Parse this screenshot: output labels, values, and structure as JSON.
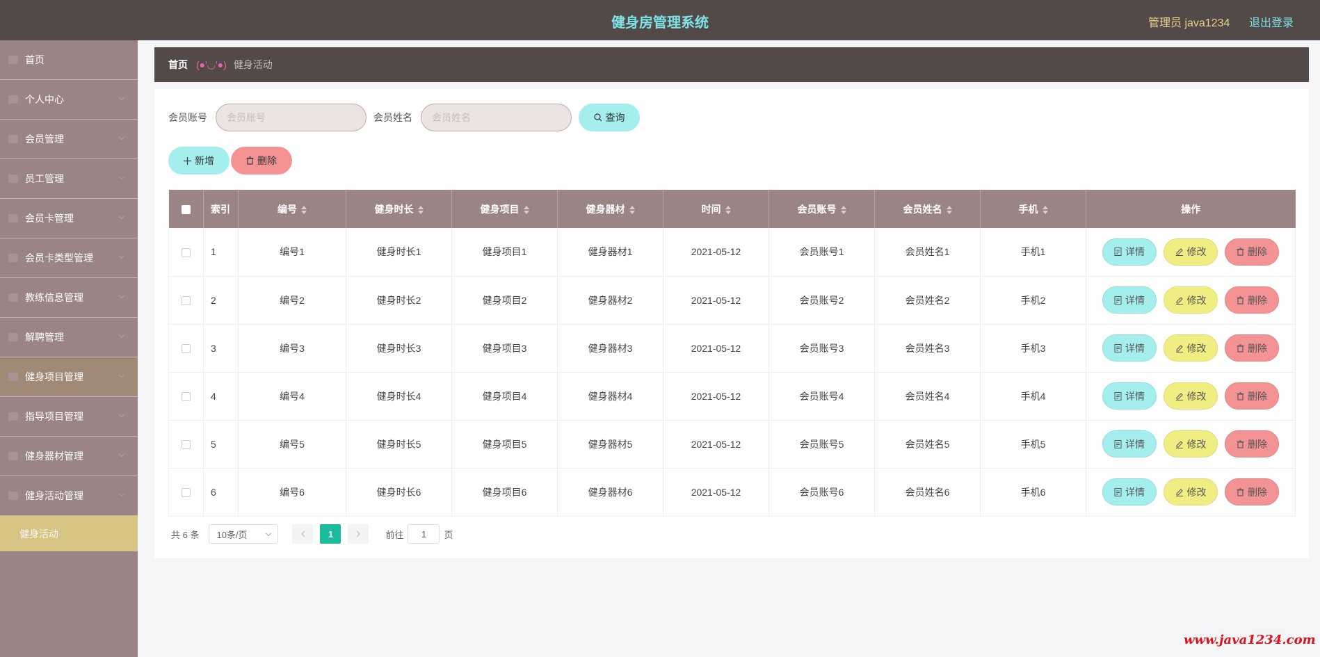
{
  "header": {
    "title": "健身房管理系统",
    "user": "管理员 java1234",
    "logout": "退出登录"
  },
  "sidebar": {
    "items": [
      {
        "label": "首页",
        "icon": "home-icon"
      },
      {
        "label": "个人中心",
        "icon": "user-icon"
      },
      {
        "label": "会员管理",
        "icon": "members-icon"
      },
      {
        "label": "员工管理",
        "icon": "staff-icon"
      },
      {
        "label": "会员卡管理",
        "icon": "card-icon"
      },
      {
        "label": "会员卡类型管理",
        "icon": "card-type-icon"
      },
      {
        "label": "教练信息管理",
        "icon": "coach-icon"
      },
      {
        "label": "解聘管理",
        "icon": "dismiss-icon"
      },
      {
        "label": "健身项目管理",
        "icon": "project-icon"
      },
      {
        "label": "指导项目管理",
        "icon": "guide-icon"
      },
      {
        "label": "健身器材管理",
        "icon": "equipment-icon"
      },
      {
        "label": "健身活动管理",
        "icon": "activity-icon"
      }
    ],
    "active_sub": "健身活动"
  },
  "breadcrumb": {
    "home": "首页",
    "separator": "(●'◡'●)",
    "current": "健身活动"
  },
  "search": {
    "account_label": "会员账号",
    "account_placeholder": "会员账号",
    "name_label": "会员姓名",
    "name_placeholder": "会员姓名",
    "query_button": "查询"
  },
  "actions": {
    "add": "新增",
    "delete": "删除"
  },
  "table": {
    "headers": [
      "索引",
      "编号",
      "健身时长",
      "健身项目",
      "健身器材",
      "时间",
      "会员账号",
      "会员姓名",
      "手机",
      "操作"
    ],
    "rows": [
      {
        "index": "1",
        "code": "编号1",
        "duration": "健身时长1",
        "project": "健身项目1",
        "equipment": "健身器材1",
        "time": "2021-05-12",
        "account": "会员账号1",
        "name": "会员姓名1",
        "phone": "手机1"
      },
      {
        "index": "2",
        "code": "编号2",
        "duration": "健身时长2",
        "project": "健身项目2",
        "equipment": "健身器材2",
        "time": "2021-05-12",
        "account": "会员账号2",
        "name": "会员姓名2",
        "phone": "手机2"
      },
      {
        "index": "3",
        "code": "编号3",
        "duration": "健身时长3",
        "project": "健身项目3",
        "equipment": "健身器材3",
        "time": "2021-05-12",
        "account": "会员账号3",
        "name": "会员姓名3",
        "phone": "手机3"
      },
      {
        "index": "4",
        "code": "编号4",
        "duration": "健身时长4",
        "project": "健身项目4",
        "equipment": "健身器材4",
        "time": "2021-05-12",
        "account": "会员账号4",
        "name": "会员姓名4",
        "phone": "手机4"
      },
      {
        "index": "5",
        "code": "编号5",
        "duration": "健身时长5",
        "project": "健身项目5",
        "equipment": "健身器材5",
        "time": "2021-05-12",
        "account": "会员账号5",
        "name": "会员姓名5",
        "phone": "手机5"
      },
      {
        "index": "6",
        "code": "编号6",
        "duration": "健身时长6",
        "project": "健身项目6",
        "equipment": "健身器材6",
        "time": "2021-05-12",
        "account": "会员账号6",
        "name": "会员姓名6",
        "phone": "手机6"
      }
    ],
    "op_detail": "详情",
    "op_edit": "修改",
    "op_delete": "删除"
  },
  "pagination": {
    "total": "共 6 条",
    "page_size": "10条/页",
    "current_page": "1",
    "goto_prefix": "前往",
    "goto_value": "1",
    "goto_suffix": "页"
  },
  "watermark": "www.java1234.com",
  "colors": {
    "header_bg": "#524949",
    "sidebar_bg": "#9b8484",
    "accent_cyan": "#a5eeee",
    "accent_yellow": "#f0ee82",
    "accent_red": "#f39394",
    "active_sub_bg": "#d6c583",
    "page_active": "#1abc9c"
  }
}
